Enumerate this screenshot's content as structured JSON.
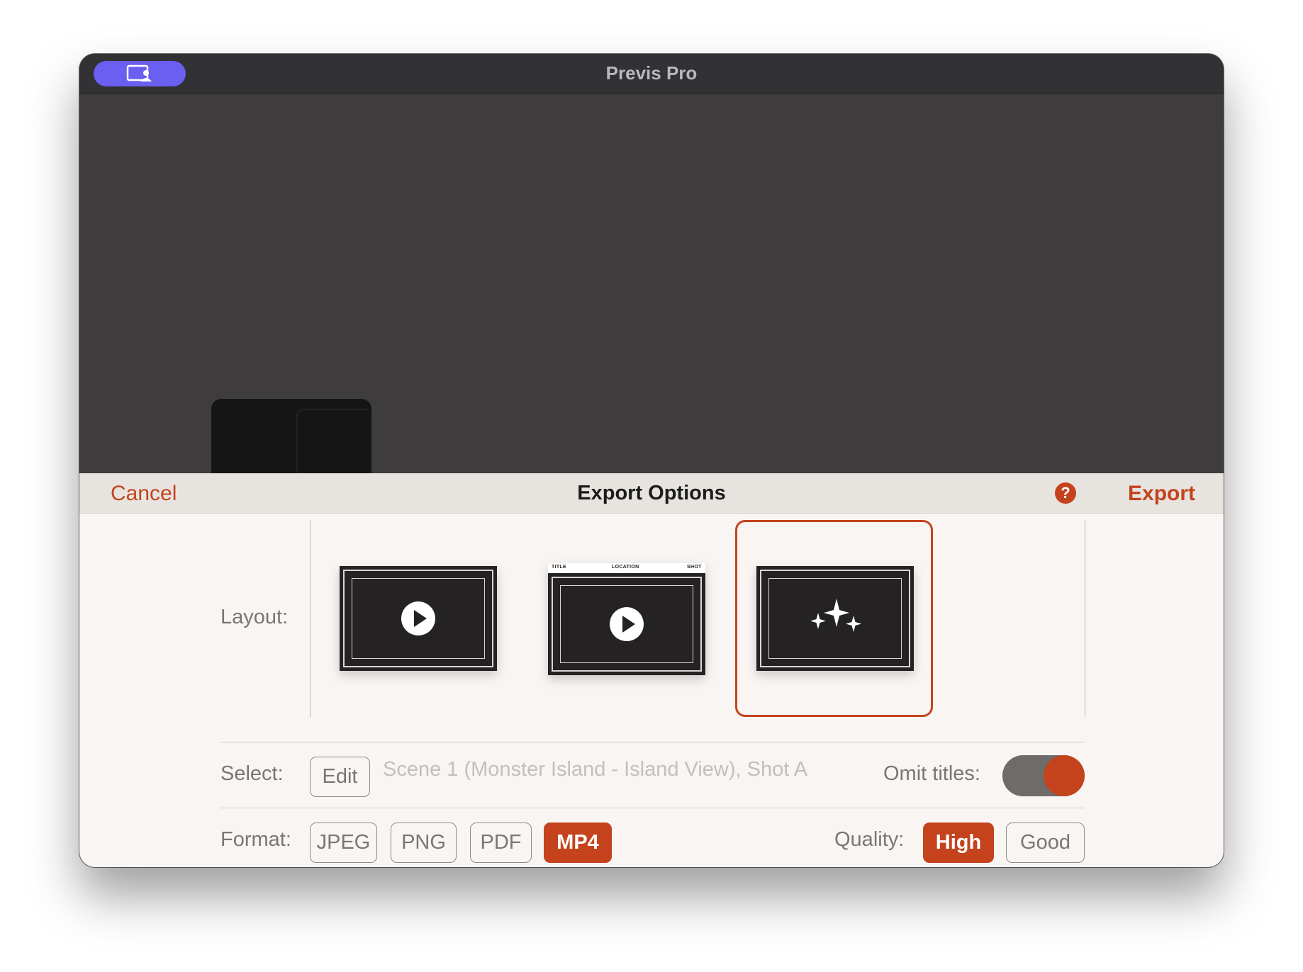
{
  "app": {
    "title": "Previs Pro",
    "screen_button_icon": "screen-share-icon"
  },
  "sheet": {
    "cancel_label": "Cancel",
    "title": "Export Options",
    "help_label": "?",
    "export_label": "Export"
  },
  "layout": {
    "label": "Layout:",
    "options": [
      {
        "name": "video-frame",
        "icon": "play-icon",
        "selected": false
      },
      {
        "name": "video-frame-with-titles",
        "icon": "play-icon",
        "selected": false,
        "header": [
          "TITLE",
          "LOCATION",
          "SHOT"
        ]
      },
      {
        "name": "animatic",
        "icon": "sparkles-icon",
        "selected": true
      }
    ]
  },
  "select": {
    "label": "Select:",
    "edit_label": "Edit",
    "selection": "Scene 1 (Monster Island - Island View), Shot A"
  },
  "omit_titles": {
    "label": "Omit titles:",
    "on": true
  },
  "format": {
    "label": "Format:",
    "options": [
      "JPEG",
      "PNG",
      "PDF",
      "MP4"
    ],
    "selected": "MP4"
  },
  "quality": {
    "label": "Quality:",
    "options": [
      "High",
      "Good"
    ],
    "selected": "High"
  },
  "colors": {
    "accent": "#c4431d",
    "titlebar": "#323133",
    "screen_button": "#6a5ff0",
    "sheet_bg": "#f8f5f3"
  }
}
